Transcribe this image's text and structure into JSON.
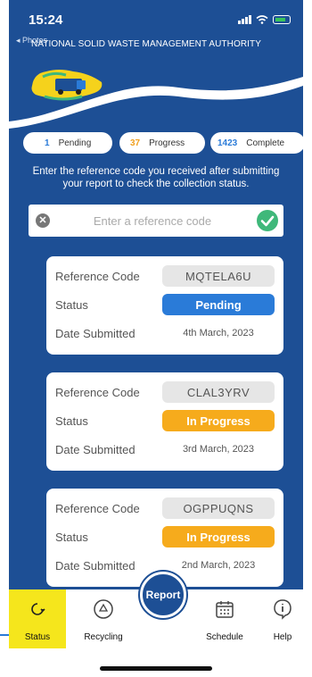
{
  "status_bar": {
    "time": "15:24",
    "back_label": "◂ Photos"
  },
  "header": {
    "authority": "NATIONAL SOLID WASTE MANAGEMENT AUTHORITY"
  },
  "counters": [
    {
      "count": "1",
      "label": "Pending"
    },
    {
      "count": "37",
      "label": "Progress"
    },
    {
      "count": "1423",
      "label": "Complete"
    }
  ],
  "instruction": "Enter the reference code you received after submitting your report to check the collection status.",
  "search": {
    "placeholder": "Enter a reference code",
    "value": ""
  },
  "labels": {
    "reference": "Reference Code",
    "status": "Status",
    "date": "Date Submitted"
  },
  "cards": [
    {
      "reference": "MQTELA6U",
      "status": "Pending",
      "date": "4th March, 2023"
    },
    {
      "reference": "CLAL3YRV",
      "status": "In Progress",
      "date": "3rd March, 2023"
    },
    {
      "reference": "OGPPUQNS",
      "status": "In Progress",
      "date": "2nd March, 2023"
    }
  ],
  "nav": {
    "status": "Status",
    "recycling": "Recycling",
    "report": "Report",
    "schedule": "Schedule",
    "help": "Help"
  },
  "colors": {
    "brand_blue": "#1d4f95",
    "pending": "#2a7bd8",
    "progress": "#f6ab1c",
    "active_tab": "#f5e61c",
    "confirm": "#3fb87a"
  }
}
